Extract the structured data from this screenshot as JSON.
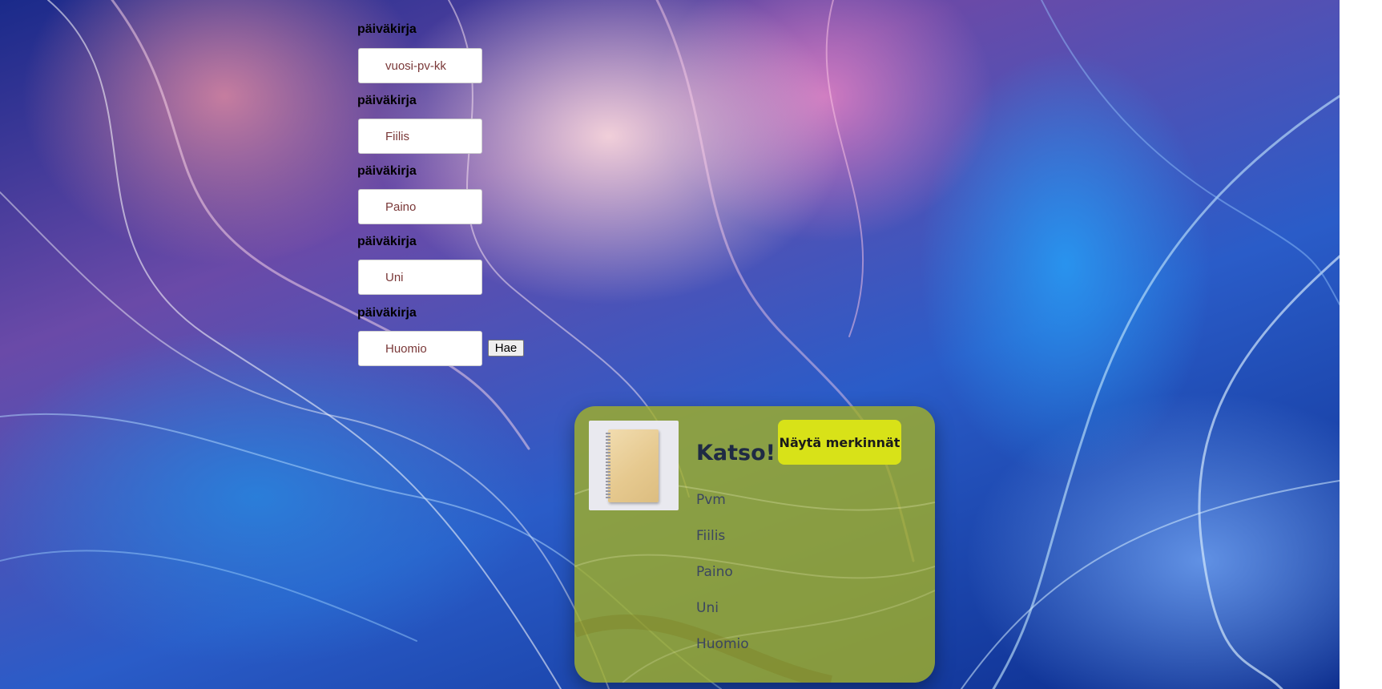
{
  "form": {
    "labels": [
      "päiväkirja",
      "päiväkirja",
      "päiväkirja",
      "päiväkirja",
      "päiväkirja"
    ],
    "placeholders": {
      "date": "vuosi-pv-kk",
      "mood": "Fiilis",
      "weight": "Paino",
      "sleep": "Uni",
      "note": "Huomio"
    },
    "search_button": "Hae"
  },
  "card": {
    "title": "Katso!",
    "show_button": "Näytä merkinnät",
    "fields": [
      "Pvm",
      "Fiilis",
      "Paino",
      "Uni",
      "Huomio"
    ]
  },
  "colors": {
    "card_background": "#a0af28",
    "show_button": "#d8e218",
    "title": "#1f2a44"
  }
}
